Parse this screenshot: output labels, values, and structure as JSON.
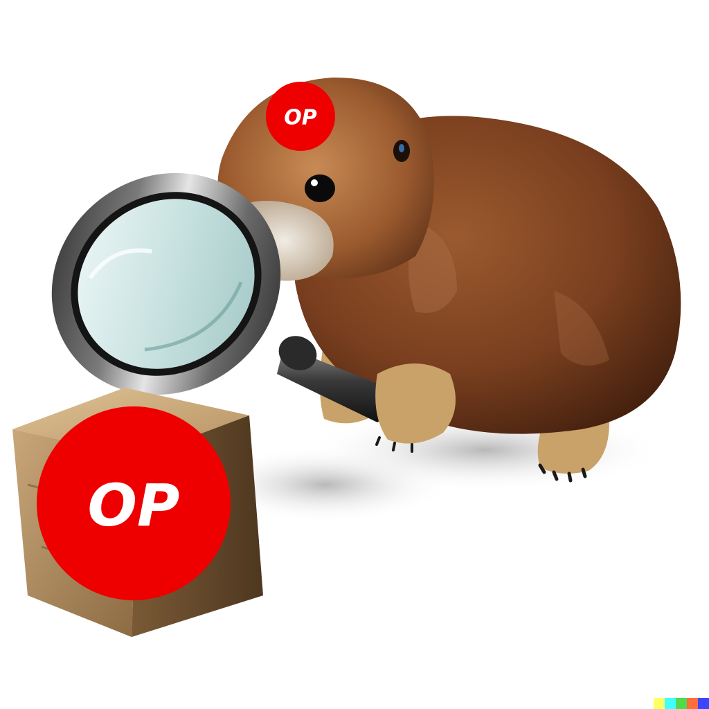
{
  "scene": {
    "small_badge": {
      "text": "OP"
    },
    "large_badge": {
      "text": "OP"
    }
  },
  "colors": {
    "background": "#ffffff",
    "badge_red": "#ee0000",
    "fur_dark": "#5a2e17",
    "fur_mid": "#8a4a26",
    "fur_light": "#c88a55",
    "magnifier_frame": "#2a2a2a",
    "magnifier_glass": "#d7ecec",
    "stone_block": "#b08a5a"
  },
  "watermark": {
    "colors": [
      "#ffff66",
      "#42ffff",
      "#51da4c",
      "#ff6e3c",
      "#3c46ff"
    ]
  }
}
